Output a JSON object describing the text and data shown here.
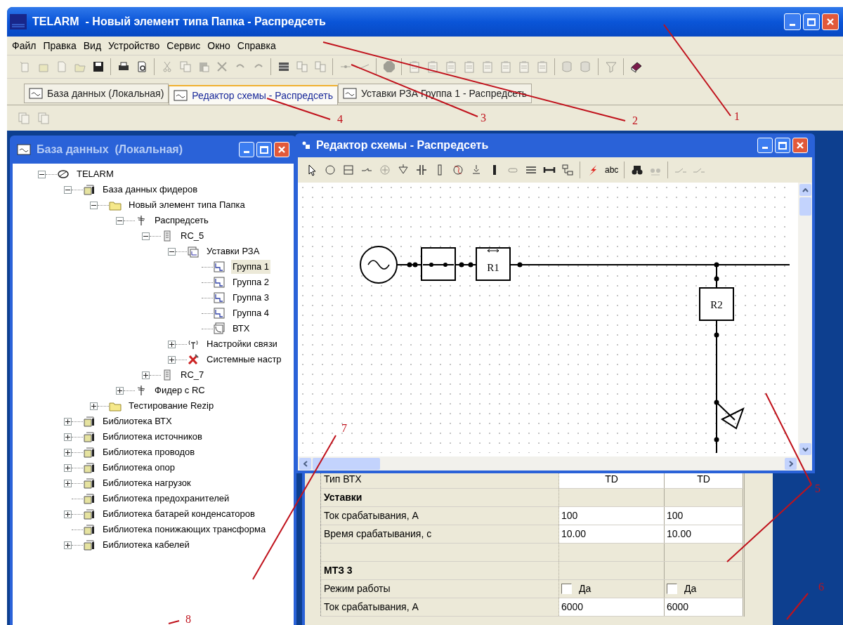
{
  "window": {
    "title": "TELARM  - Новый элемент типа Папка - Распредсеть"
  },
  "menu": [
    "Файл",
    "Правка",
    "Вид",
    "Устройство",
    "Сервис",
    "Окно",
    "Справка"
  ],
  "tabs": [
    {
      "label": "База данных (Локальная)",
      "selected": false
    },
    {
      "label": "Редактор схемы - Распредсеть",
      "selected": true
    },
    {
      "label": "Уставки РЗА  Группа 1 - Распредсеть",
      "selected": false
    }
  ],
  "tree_window": {
    "title": "База данных  (Локальная)",
    "items": [
      {
        "kind": "root",
        "label": "TELARM",
        "expanded": true,
        "selected": false,
        "children": [
          {
            "kind": "db",
            "label": "База данных фидеров",
            "expanded": true,
            "selected": false,
            "children": [
              {
                "kind": "folder",
                "label": "Новый элемент типа Папка",
                "expanded": true,
                "selected": false,
                "children": [
                  {
                    "kind": "feeder",
                    "label": "Распредсеть",
                    "expanded": true,
                    "selected": false,
                    "children": [
                      {
                        "kind": "device",
                        "label": "RC_5",
                        "expanded": true,
                        "selected": false,
                        "children": [
                          {
                            "kind": "settings",
                            "label": "Уставки РЗА",
                            "expanded": true,
                            "selected": false,
                            "children": [
                              {
                                "kind": "group",
                                "label": "Группа 1",
                                "selected": true
                              },
                              {
                                "kind": "group",
                                "label": "Группа 2",
                                "selected": false
                              },
                              {
                                "kind": "group",
                                "label": "Группа 3",
                                "selected": false
                              },
                              {
                                "kind": "group",
                                "label": "Группа 4",
                                "selected": false
                              },
                              {
                                "kind": "curve",
                                "label": "ВТХ",
                                "selected": false
                              }
                            ]
                          },
                          {
                            "kind": "comm",
                            "label": "Настройки связи",
                            "expanded": false,
                            "selected": false
                          },
                          {
                            "kind": "tools",
                            "label": "Системные настр",
                            "expanded": false,
                            "selected": false
                          }
                        ]
                      },
                      {
                        "kind": "device",
                        "label": "RC_7",
                        "expanded": false,
                        "selected": false
                      }
                    ]
                  },
                  {
                    "kind": "feeder",
                    "label": "Фидер с RC",
                    "expanded": false,
                    "selected": false
                  }
                ]
              },
              {
                "kind": "folder",
                "label": "Тестирование Rezip",
                "expanded": false,
                "selected": false
              }
            ]
          },
          {
            "kind": "db",
            "label": "Библиотека ВТХ",
            "expanded": false,
            "selected": false
          },
          {
            "kind": "db",
            "label": "Библиотека источников",
            "expanded": false,
            "selected": false
          },
          {
            "kind": "db",
            "label": "Библиотека проводов",
            "expanded": false,
            "selected": false
          },
          {
            "kind": "db",
            "label": "Библиотека опор",
            "expanded": false,
            "selected": false
          },
          {
            "kind": "db",
            "label": "Библиотека нагрузок",
            "expanded": false,
            "selected": false
          },
          {
            "kind": "db",
            "label": "Библиотека предохранителей",
            "selected": false
          },
          {
            "kind": "db",
            "label": "Библиотека батарей конденсаторов",
            "expanded": false,
            "selected": false
          },
          {
            "kind": "db",
            "label": "Библиотека понижающих трансформа",
            "selected": false
          },
          {
            "kind": "db",
            "label": "Библиотека кабелей",
            "expanded": false,
            "selected": false
          }
        ]
      }
    ]
  },
  "diagram_window": {
    "title": "Редактор схемы - Распредсеть",
    "text_tool": "abc",
    "blocks": [
      "R1",
      "R2"
    ]
  },
  "properties": {
    "rows": [
      {
        "kind": "value",
        "label": "Тип ВТХ",
        "column_2": "TD",
        "column_3": "TD"
      },
      {
        "kind": "section",
        "label": "Уставки"
      },
      {
        "kind": "value",
        "label": "Ток срабатывания, А",
        "column_2": "100",
        "column_3": "100"
      },
      {
        "kind": "value",
        "label": "Время срабатывания, с",
        "column_2": "10.00",
        "column_3": "10.00"
      },
      {
        "kind": "blank"
      },
      {
        "kind": "section",
        "label": "МТЗ 3"
      },
      {
        "kind": "check",
        "label": "Режим работы",
        "column_2": "Да",
        "column_2_checked": false,
        "column_3": "Да",
        "column_3_checked": false
      },
      {
        "kind": "value",
        "label": "Ток срабатывания, А",
        "column_2": "6000",
        "column_3": "6000"
      }
    ]
  },
  "annotations": [
    "4",
    "3",
    "2",
    "1",
    "7",
    "5",
    "6",
    "8"
  ]
}
